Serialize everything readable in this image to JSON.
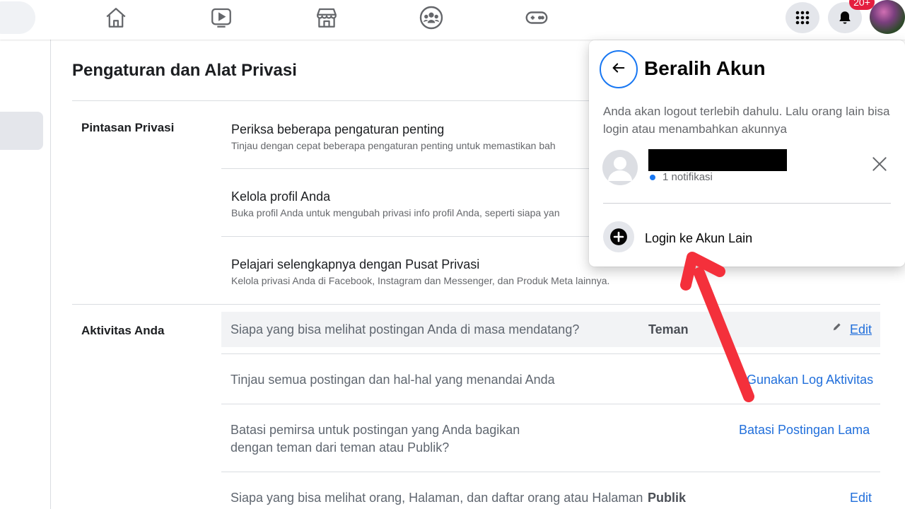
{
  "topbar": {
    "nav_icons": [
      "home-icon",
      "watch-icon",
      "marketplace-icon",
      "groups-icon",
      "gaming-icon"
    ],
    "notification_badge": "20+"
  },
  "settings": {
    "title": "Pengaturan dan Alat Privasi",
    "privacy_shortcuts": {
      "label": "Pintasan Privasi",
      "items": [
        {
          "title": "Periksa beberapa pengaturan penting",
          "subtitle": "Tinjau dengan cepat beberapa pengaturan penting untuk memastikan bah"
        },
        {
          "title": "Kelola profil Anda",
          "subtitle": "Buka profil Anda untuk mengubah privasi info profil Anda, seperti siapa yan"
        },
        {
          "title": "Pelajari selengkapnya dengan Pusat Privasi",
          "subtitle": "Kelola privasi Anda di Facebook, Instagram dan Messenger, dan Produk Meta lainnya."
        }
      ]
    },
    "your_activity": {
      "label": "Aktivitas Anda",
      "rows": [
        {
          "question": "Siapa yang bisa melihat postingan Anda di masa mendatang?",
          "value": "Teman",
          "action": "Edit"
        },
        {
          "question": "Tinjau semua postingan dan hal-hal yang menandai Anda",
          "value": "",
          "action": "Gunakan Log Aktivitas"
        },
        {
          "question_line1": "Batasi pemirsa untuk postingan yang Anda bagikan",
          "question_line2": "dengan teman dari teman atau Publik?",
          "value": "",
          "action": "Batasi Postingan Lama"
        },
        {
          "question": "Siapa yang bisa melihat orang, Halaman, dan daftar orang atau Halaman",
          "value": "Publik",
          "action": "Edit"
        }
      ]
    }
  },
  "switch_account": {
    "title": "Beralih Akun",
    "description": "Anda akan logout terlebih dahulu. Lalu orang lain bisa login atau menambahkan akunnya",
    "account": {
      "notification": "1 notifikasi"
    },
    "login_other": "Login ke Akun Lain"
  },
  "colors": {
    "facebook_blue": "#1877f2",
    "link_blue": "#216fdb",
    "badge_red": "#e41e3f",
    "annotation_arrow": "#f4303b"
  }
}
